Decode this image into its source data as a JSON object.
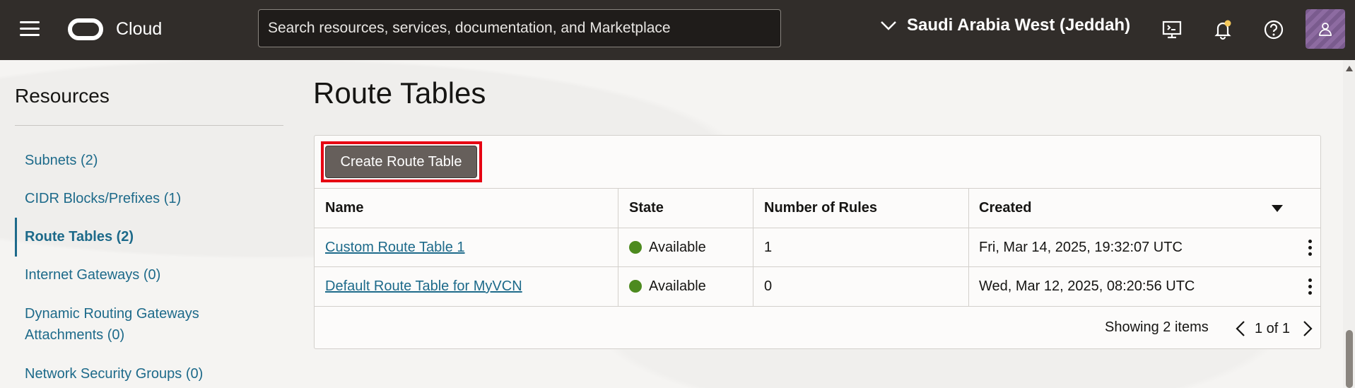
{
  "header": {
    "brand": "Cloud",
    "search_placeholder": "Search resources, services, documentation, and Marketplace",
    "region": "Saudi Arabia West (Jeddah)",
    "icons": [
      "menu-icon",
      "oracle-logo-icon",
      "chevron-down-icon",
      "cloud-shell-icon",
      "bell-icon",
      "help-icon",
      "user-icon"
    ]
  },
  "sidebar": {
    "title": "Resources",
    "items": [
      {
        "label": "Subnets (2)"
      },
      {
        "label": "CIDR Blocks/Prefixes (1)"
      },
      {
        "label": "Route Tables (2)"
      },
      {
        "label": "Internet Gateways (0)"
      },
      {
        "label": "Dynamic Routing Gateways"
      },
      {
        "label": "Attachments (0)"
      },
      {
        "label": "Network Security Groups (0)"
      }
    ],
    "active_index": 2
  },
  "main": {
    "title": "Route Tables",
    "create_button": "Create Route Table",
    "columns": [
      "Name",
      "State",
      "Number of Rules",
      "Created"
    ],
    "rows": [
      {
        "name": "Custom Route Table 1",
        "state": "Available",
        "rules": "1",
        "created": "Fri, Mar 14, 2025, 19:32:07 UTC"
      },
      {
        "name": "Default Route Table for MyVCN",
        "state": "Available",
        "rules": "0",
        "created": "Wed, Mar 12, 2025, 08:20:56 UTC"
      }
    ],
    "showing": "Showing 2 items",
    "pagination": "1 of 1"
  },
  "colors": {
    "header_bg": "#312d2a",
    "link": "#1d6a8a",
    "available": "#4d8a1f",
    "highlight": "#e60012",
    "button_bg": "#665f5b"
  }
}
